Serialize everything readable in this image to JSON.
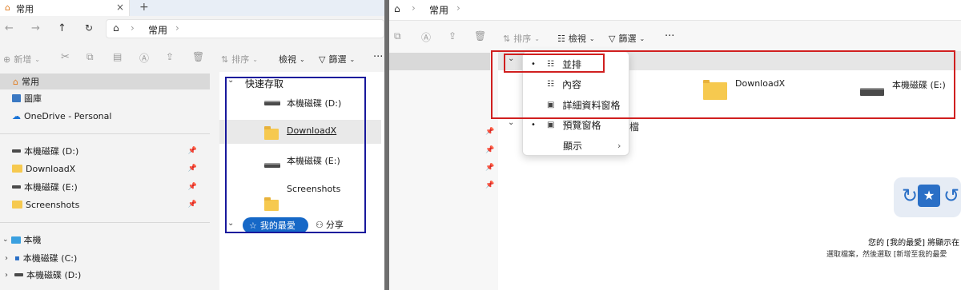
{
  "left": {
    "tab": {
      "label": "常用",
      "close": "×",
      "new": "+"
    },
    "address": {
      "path": "常用",
      "sep": "›"
    },
    "toolbar": {
      "new_label": "新增",
      "sort_label": "排序",
      "view_label": "檢視",
      "filter_label": "篩選",
      "more": "···"
    },
    "nav": [
      {
        "label": "常用",
        "icon": "home-icon",
        "selected": true
      },
      {
        "label": "圖庫",
        "icon": "gallery-icon"
      },
      {
        "label": "OneDrive - Personal",
        "icon": "cloud-icon"
      },
      {
        "label": "本機磁碟 (D:)",
        "icon": "drive-icon",
        "pinned": true
      },
      {
        "label": "DownloadX",
        "icon": "folder-icon",
        "pinned": true
      },
      {
        "label": "本機磁碟 (E:)",
        "icon": "drive-icon",
        "pinned": true
      },
      {
        "label": "Screenshots",
        "icon": "folder-icon",
        "pinned": true
      },
      {
        "label": "本機",
        "icon": "computer-icon"
      },
      {
        "label": "本機磁碟 (C:)",
        "icon": "drive-icon"
      },
      {
        "label": "本機磁碟 (D:)",
        "icon": "drive-icon"
      }
    ],
    "quick": {
      "header": "快速存取",
      "items": [
        {
          "label": "本機磁碟 (D:)",
          "icon": "drive-icon"
        },
        {
          "label": "DownloadX",
          "icon": "folder-icon"
        },
        {
          "label": "本機磁碟 (E:)",
          "icon": "drive-icon"
        },
        {
          "label": "Screenshots",
          "icon": "folder-icon"
        }
      ],
      "fav_button": "我的最愛",
      "share_button": "分享"
    }
  },
  "right": {
    "address": {
      "path": "常用",
      "sep": "›"
    },
    "toolbar": {
      "sort_label": "排序",
      "view_label": "檢視",
      "filter_label": "篩選",
      "more": "···"
    },
    "menu": {
      "items": [
        {
          "label": "並排",
          "bullet": "•"
        },
        {
          "label": "內容"
        },
        {
          "label": "詳細資料窗格"
        },
        {
          "label": "預覽窗格",
          "bullet": "•"
        },
        {
          "label": "顯示",
          "submenu": "›"
        }
      ]
    },
    "content": {
      "items": [
        {
          "label": "DownloadX",
          "icon": "folder-icon"
        },
        {
          "label": "本機磁碟 (E:)",
          "icon": "drive-icon"
        }
      ],
      "partial_char": "檔",
      "fav_msg": "您的 [我的最愛] 將顯示在",
      "fav_hint": "選取檔案，然後選取 [新增至我的最愛"
    }
  },
  "colors": {
    "red_box": "#d01f1f",
    "blue_box": "#18189c",
    "accent": "#1668c7"
  }
}
